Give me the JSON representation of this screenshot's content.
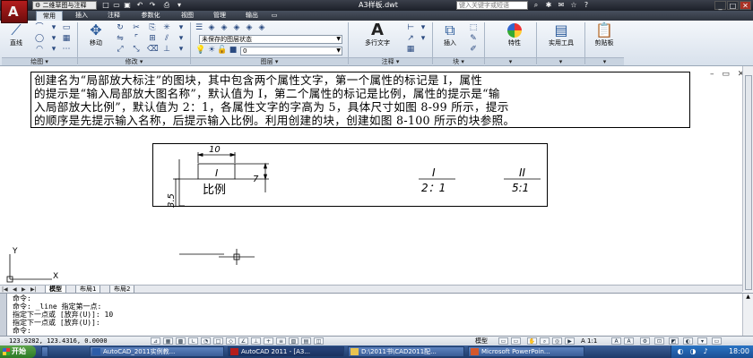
{
  "titlebar": {
    "app_logo": "A",
    "workspace": "二维草图与注释",
    "doc_title": "A3样板.dwt",
    "search_placeholder": "键入关键字或短语"
  },
  "ribbon": {
    "tabs": [
      "常用",
      "插入",
      "注释",
      "参数化",
      "视图",
      "管理",
      "输出"
    ],
    "active_tab": "常用",
    "tools": {
      "line": "直线",
      "move": "移动",
      "layer_state": "未保存的图层状态",
      "mtext": "多行文字",
      "insert": "插入",
      "properties": "特性",
      "utilities": "实用工具",
      "clipboard": "剪贴板"
    },
    "panels": {
      "draw": "绘图",
      "modify": "修改",
      "layers": "图层",
      "annotation": "注释",
      "block": "块"
    }
  },
  "document": {
    "text_lines": [
      "创建名为“局部放大标注”的图块，其中包含两个属性文字，第一个属性的标记是 I，属性",
      "的提示是“输入局部放大图名称”，默认值为 I，第二个属性的标记是比例，属性的提示是“输",
      "入局部放大比例”，默认值为 2：1，各属性文字的字高为 5，具体尺寸如图 8-99 所示，提示",
      "的顺序是先提示输入名称，后提示输入比例。利用创建的块，创建如图 8-100 所示的块参照。"
    ],
    "figure": {
      "dim_top": "10",
      "dim_right": "7",
      "dim_left": "3.5",
      "attr_name": "I",
      "attr_scale": "比例",
      "ref1_top": "I",
      "ref1_bottom": "2：1",
      "ref2_top": "II",
      "ref2_bottom": "5:1"
    },
    "ucs": {
      "x": "X",
      "y": "Y"
    }
  },
  "model_tabs": [
    "模型",
    "布局1",
    "布局2"
  ],
  "command": {
    "lines": [
      "命令:",
      "命令: _line 指定第一点:",
      "指定下一点或 [放弃(U)]: 10",
      "指定下一点或 [放弃(U)]:"
    ],
    "prompt": "命令:"
  },
  "statusbar": {
    "coords": "123.9282, 123.4316, 0.0000",
    "model": "模型",
    "scale": "A 1:1"
  },
  "taskbar": {
    "start": "开始",
    "tasks": [
      "AutoCAD_2011实例教...",
      "AutoCAD 2011 - [A3...",
      "D:\\2011书\\CAD2011配...",
      "Microsoft PowerPoin..."
    ],
    "clock": "18:00"
  }
}
